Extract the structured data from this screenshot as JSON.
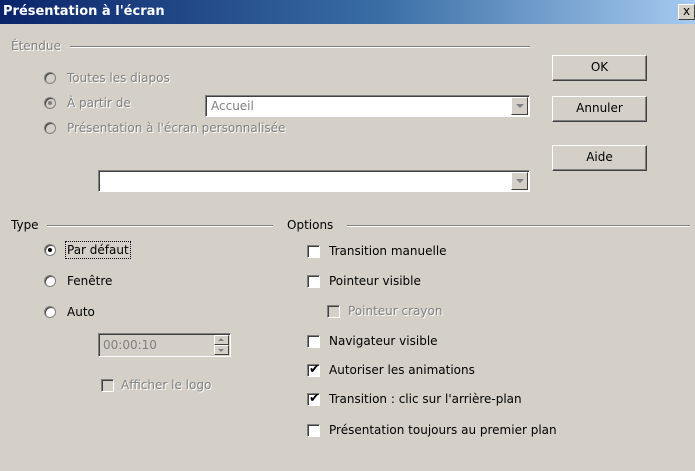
{
  "window": {
    "title": "Présentation à l'écran",
    "close_glyph": "x"
  },
  "range": {
    "heading": "Étendue",
    "all_slides": "Toutes les diapos",
    "from": "À partir de",
    "from_value": "Accueil",
    "custom": "Présentation à l'écran personnalisée",
    "custom_value": ""
  },
  "type": {
    "heading": "Type",
    "default": "Par défaut",
    "window": "Fenêtre",
    "auto": "Auto",
    "pause": "00:00:10",
    "show_logo": "Afficher le logo"
  },
  "options": {
    "heading": "Options",
    "manual_transition": "Transition manuelle",
    "pointer_visible": "Pointeur visible",
    "pointer_pen": "Pointeur crayon",
    "navigator_visible": "Navigateur visible",
    "allow_animations": "Autoriser les animations",
    "transition_click": "Transition : clic sur l'arrière-plan",
    "always_on_top": "Présentation toujours au premier plan"
  },
  "checked": {
    "manual_transition": false,
    "pointer_visible": false,
    "pointer_pen": false,
    "navigator_visible": false,
    "allow_animations": true,
    "transition_click": true,
    "always_on_top": false,
    "show_logo": false
  },
  "selected": {
    "range": "from",
    "type": "default"
  },
  "buttons": {
    "ok": "OK",
    "cancel": "Annuler",
    "help": "Aide"
  },
  "glyphs": {
    "checkmark": "✔"
  },
  "colors": {
    "title_start": "#0a246a",
    "title_end": "#a6caf0",
    "face": "#d4d0c8",
    "disabled": "#808080"
  }
}
